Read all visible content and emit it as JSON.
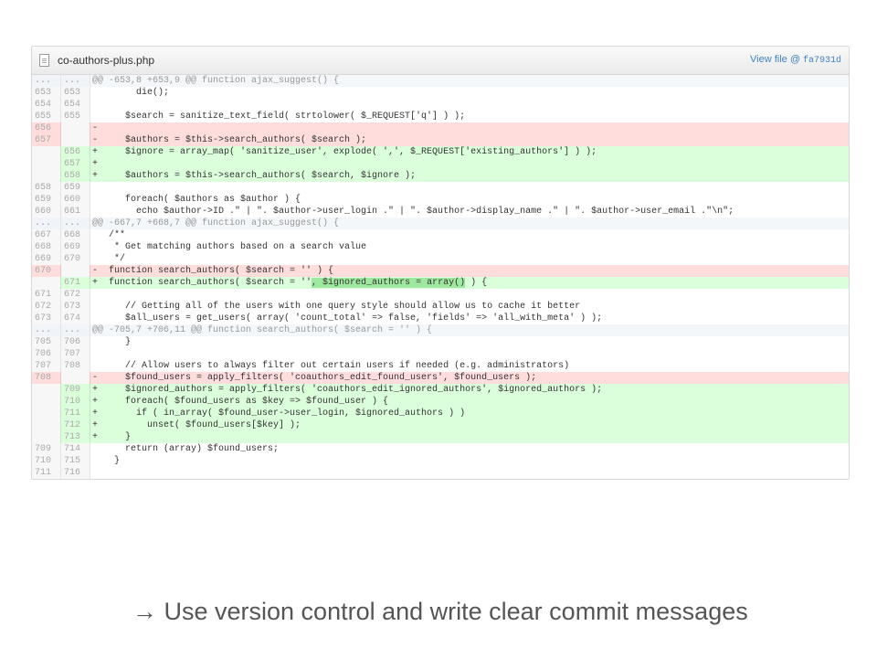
{
  "file": {
    "name": "co-authors-plus.php",
    "view_label": "View file @",
    "sha": "fa7931d"
  },
  "diff": [
    {
      "type": "hunk",
      "old": "...",
      "new": "...",
      "text": "@@ -653,8 +653,9 @@ function ajax_suggest() {"
    },
    {
      "type": "context",
      "old": "653",
      "new": "653",
      "text": "        die();"
    },
    {
      "type": "context",
      "old": "654",
      "new": "654",
      "text": ""
    },
    {
      "type": "context",
      "old": "655",
      "new": "655",
      "text": "      $search = sanitize_text_field( strtolower( $_REQUEST['q'] ) );"
    },
    {
      "type": "del",
      "old": "656",
      "new": "",
      "text": "-"
    },
    {
      "type": "del",
      "old": "657",
      "new": "",
      "text": "-     $authors = $this->search_authors( $search );"
    },
    {
      "type": "add",
      "old": "",
      "new": "656",
      "text": "+     $ignore = array_map( 'sanitize_user', explode( ',', $_REQUEST['existing_authors'] ) );"
    },
    {
      "type": "add",
      "old": "",
      "new": "657",
      "text": "+"
    },
    {
      "type": "add",
      "old": "",
      "new": "658",
      "text": "+     $authors = $this->search_authors( $search, $ignore );"
    },
    {
      "type": "context",
      "old": "658",
      "new": "659",
      "text": ""
    },
    {
      "type": "context",
      "old": "659",
      "new": "660",
      "text": "      foreach( $authors as $author ) {"
    },
    {
      "type": "context",
      "old": "660",
      "new": "661",
      "text": "        echo $author->ID .\" | \". $author->user_login .\" | \". $author->display_name .\" | \". $author->user_email .\"\\n\";"
    },
    {
      "type": "hunk",
      "old": "...",
      "new": "...",
      "text": "@@ -667,7 +668,7 @@ function ajax_suggest() {"
    },
    {
      "type": "context",
      "old": "667",
      "new": "668",
      "text": "   /**"
    },
    {
      "type": "context",
      "old": "668",
      "new": "669",
      "text": "    * Get matching authors based on a search value"
    },
    {
      "type": "context",
      "old": "669",
      "new": "670",
      "text": "    */"
    },
    {
      "type": "del",
      "old": "670",
      "new": "",
      "text": "-  function search_authors( $search = '' ) {"
    },
    {
      "type": "add",
      "old": "",
      "new": "671",
      "text": "+  function search_authors( $search = ''",
      "hl": ", $ignored_authors = array()",
      "tail": " ) {"
    },
    {
      "type": "context",
      "old": "671",
      "new": "672",
      "text": ""
    },
    {
      "type": "context",
      "old": "672",
      "new": "673",
      "text": "      // Getting all of the users with one query style should allow us to cache it better"
    },
    {
      "type": "context",
      "old": "673",
      "new": "674",
      "text": "      $all_users = get_users( array( 'count_total' => false, 'fields' => 'all_with_meta' ) );"
    },
    {
      "type": "hunk",
      "old": "...",
      "new": "...",
      "text": "@@ -705,7 +706,11 @@ function search_authors( $search = '' ) {"
    },
    {
      "type": "context",
      "old": "705",
      "new": "706",
      "text": "      }"
    },
    {
      "type": "context",
      "old": "706",
      "new": "707",
      "text": ""
    },
    {
      "type": "context",
      "old": "707",
      "new": "708",
      "text": "      // Allow users to always filter out certain users if needed (e.g. administrators)"
    },
    {
      "type": "del",
      "old": "708",
      "new": "",
      "text": "-     $found_users = apply_filters( 'coauthors_edit_found_users', $found_users );"
    },
    {
      "type": "add",
      "old": "",
      "new": "709",
      "text": "+     $ignored_authors = apply_filters( 'coauthors_edit_ignored_authors', $ignored_authors );"
    },
    {
      "type": "add",
      "old": "",
      "new": "710",
      "text": "+     foreach( $found_users as $key => $found_user ) {"
    },
    {
      "type": "add",
      "old": "",
      "new": "711",
      "text": "+       if ( in_array( $found_user->user_login, $ignored_authors ) )"
    },
    {
      "type": "add",
      "old": "",
      "new": "712",
      "text": "+         unset( $found_users[$key] );"
    },
    {
      "type": "add",
      "old": "",
      "new": "713",
      "text": "+     }"
    },
    {
      "type": "context",
      "old": "709",
      "new": "714",
      "text": "      return (array) $found_users;"
    },
    {
      "type": "context",
      "old": "710",
      "new": "715",
      "text": "    }"
    },
    {
      "type": "context",
      "old": "711",
      "new": "716",
      "text": ""
    }
  ],
  "caption": "→ Use version control and write clear commit messages",
  "colors": {
    "added": "#dbffdb",
    "deleted": "#ffdddd",
    "highlight": "#9fe89f",
    "link": "#4183c4"
  }
}
